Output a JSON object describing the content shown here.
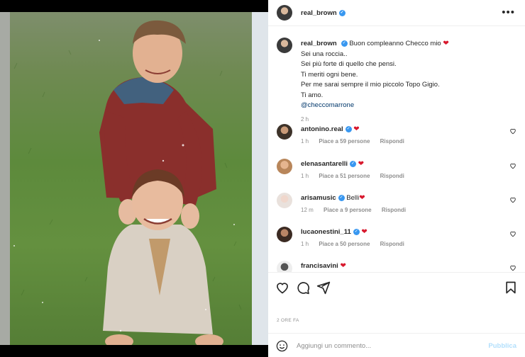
{
  "post": {
    "username": "real_brown",
    "verified": true,
    "photo_alt_icon": "post-photo"
  },
  "caption": {
    "username": "real_brown",
    "lines": [
      "Buon compleanno Checco mio",
      "Sei una roccia..",
      "Sei più forte di quello che pensi.",
      "Ti meriti ogni bene.",
      "Per me sarai sempre il mio piccolo Topo Gigio.",
      "Ti amo."
    ],
    "mention": "@checcomarrone",
    "time": "2 h",
    "emoji": "❤"
  },
  "comments": [
    {
      "username": "antonino.real",
      "verified": true,
      "text": "",
      "emoji": "❤",
      "time": "1 h",
      "likes": "Piace a 59 persone",
      "reply": "Rispondi"
    },
    {
      "username": "elenasantarelli",
      "verified": true,
      "text": "",
      "emoji": "❤",
      "time": "1 h",
      "likes": "Piace a 51 persone",
      "reply": "Rispondi"
    },
    {
      "username": "arisamusic",
      "verified": true,
      "text": "Belli",
      "emoji": "❤",
      "time": "12 m",
      "likes": "Piace a 9 persone",
      "reply": "Rispondi"
    },
    {
      "username": "lucaonestini_11",
      "verified": true,
      "text": "",
      "emoji": "❤",
      "time": "1 h",
      "likes": "Piace a 50 persone",
      "reply": "Rispondi"
    },
    {
      "username": "francisavini",
      "verified": false,
      "text": "",
      "emoji": "❤",
      "time": "",
      "likes": "",
      "reply": ""
    }
  ],
  "actions": {
    "icons": [
      "heart-icon",
      "comment-icon",
      "share-icon",
      "bookmark-icon"
    ],
    "time_label": "2 ORE FA"
  },
  "add_comment": {
    "placeholder": "Aggiungi un commento...",
    "publish_label": "Pubblica"
  },
  "colors": {
    "verified": "#3897f0",
    "heart": "#d8182d",
    "link": "#00376b",
    "muted": "#8e8e8e",
    "publish_disabled": "#b2dffc"
  }
}
